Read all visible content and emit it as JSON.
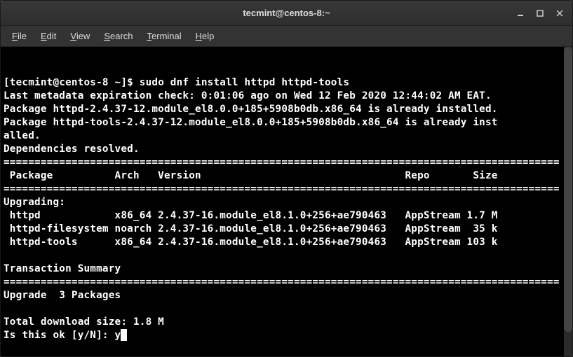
{
  "window": {
    "title": "tecmint@centos-8:~"
  },
  "menu": {
    "file": "File",
    "edit": "Edit",
    "view": "View",
    "search": "Search",
    "terminal": "Terminal",
    "help": "Help"
  },
  "terminal": {
    "prompt_user": "[tecmint@centos-8 ~]$ ",
    "command": "sudo dnf install httpd httpd-tools",
    "line1": "Last metadata expiration check: 0:01:06 ago on Wed 12 Feb 2020 12:44:02 AM EAT.",
    "line2": "Package httpd-2.4.37-12.module_el8.0.0+185+5908b0db.x86_64 is already installed.",
    "line3": "Package httpd-tools-2.4.37-12.module_el8.0.0+185+5908b0db.x86_64 is already inst",
    "line3b": "alled.",
    "line4": "Dependencies resolved.",
    "separator": "==========================================================================================",
    "header": " Package          Arch   Version                                 Repo       Size",
    "upgrading": "Upgrading:",
    "row1": " httpd            x86_64 2.4.37-16.module_el8.1.0+256+ae790463   AppStream 1.7 M",
    "row2": " httpd-filesystem noarch 2.4.37-16.module_el8.1.0+256+ae790463   AppStream  35 k",
    "row3": " httpd-tools      x86_64 2.4.37-16.module_el8.1.0+256+ae790463   AppStream 103 k",
    "trans_header": "Transaction Summary",
    "upgrade_count": "Upgrade  3 Packages",
    "download_size": "Total download size: 1.8 M",
    "prompt_ok": "Is this ok [y/N]: ",
    "user_input": "y"
  }
}
